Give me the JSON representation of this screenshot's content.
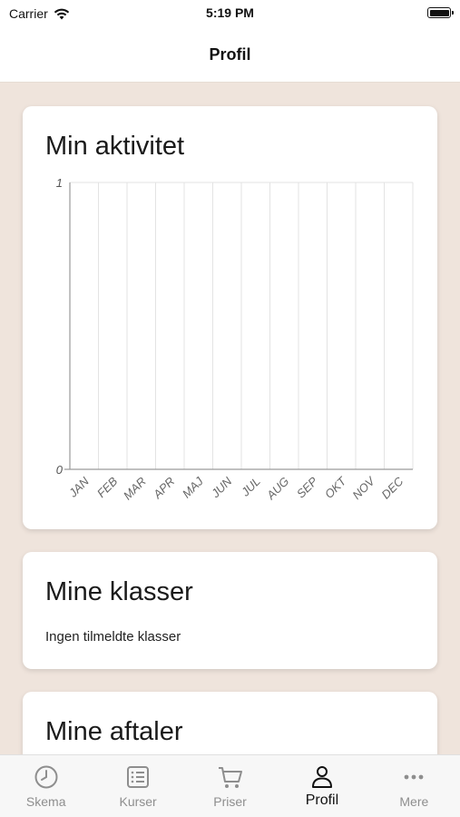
{
  "status_bar": {
    "carrier": "Carrier",
    "time": "5:19 PM"
  },
  "nav": {
    "title": "Profil"
  },
  "activity": {
    "title": "Min aktivitet"
  },
  "chart_data": {
    "type": "line",
    "categories": [
      "JAN",
      "FEB",
      "MAR",
      "APR",
      "MAJ",
      "JUN",
      "JUL",
      "AUG",
      "SEP",
      "OKT",
      "NOV",
      "DEC"
    ],
    "series": [
      {
        "values": [
          0,
          0,
          0,
          0,
          0,
          0,
          0,
          0,
          0,
          0,
          0,
          0
        ]
      }
    ],
    "ylim": [
      0,
      1
    ],
    "y_ticks": [
      "0",
      "1"
    ],
    "grid": true,
    "xlabel": "",
    "ylabel": ""
  },
  "classes": {
    "title": "Mine klasser",
    "empty_text": "Ingen tilmeldte klasser"
  },
  "appointments": {
    "title": "Mine aftaler"
  },
  "tabs": [
    {
      "label": "Skema",
      "icon": "clock-icon"
    },
    {
      "label": "Kurser",
      "icon": "list-icon"
    },
    {
      "label": "Priser",
      "icon": "cart-icon"
    },
    {
      "label": "Profil",
      "icon": "person-icon"
    },
    {
      "label": "Mere",
      "icon": "more-icon"
    }
  ],
  "colors": {
    "background": "#efe4dc",
    "active_tab": "#111111",
    "inactive_tab": "#8e8e8e"
  }
}
